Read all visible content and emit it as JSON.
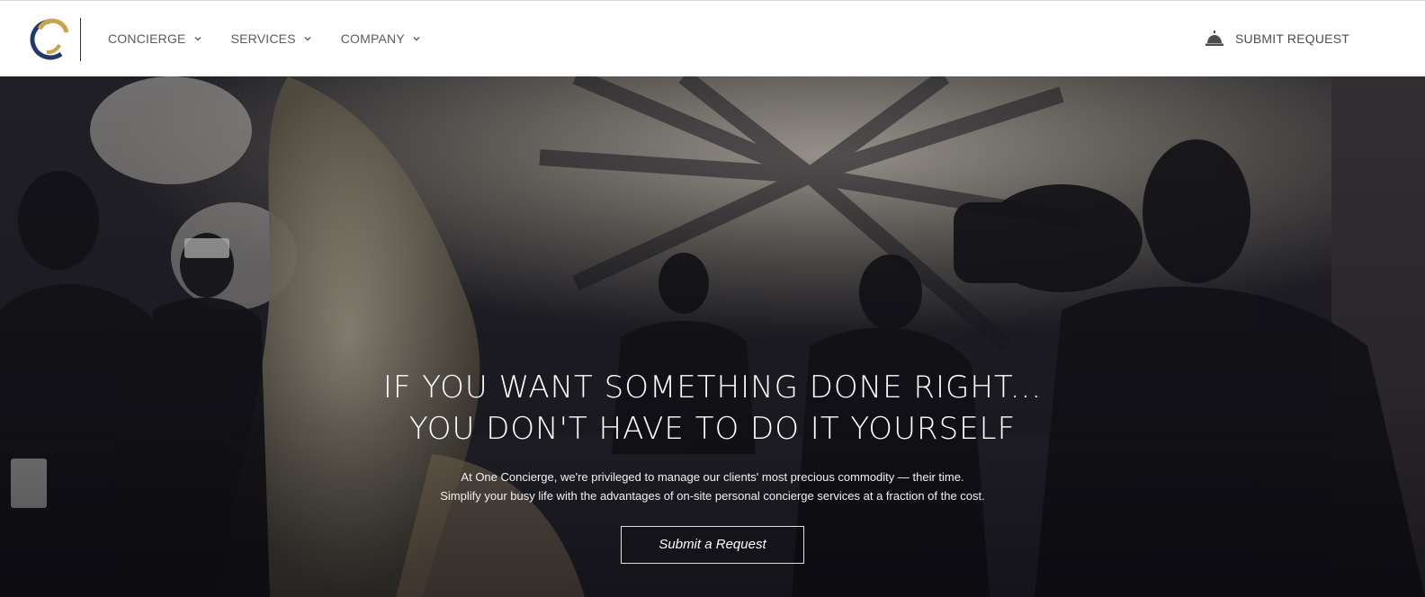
{
  "brand": {
    "name": "One Concierge",
    "colors": {
      "gold": "#c9a24a",
      "navy": "#1f3a68"
    }
  },
  "nav": {
    "items": [
      {
        "label": "CONCIERGE",
        "icon": "chevron-down-icon"
      },
      {
        "label": "SERVICES",
        "icon": "chevron-down-icon"
      },
      {
        "label": "COMPANY",
        "icon": "chevron-down-icon"
      }
    ],
    "submit_label": "SUBMIT REQUEST",
    "submit_icon": "concierge-bell-icon"
  },
  "hero": {
    "headline_line1": "IF YOU WANT SOMETHING DONE RIGHT...",
    "headline_line2": "YOU DON'T HAVE TO DO IT YOURSELF",
    "sub_line1": "At One Concierge, we're privileged to manage our clients' most precious commodity — their time.",
    "sub_line2": "Simplify your busy life with the advantages of on-site personal concierge services at a fraction of the cost.",
    "cta_label": "Submit a Request"
  }
}
